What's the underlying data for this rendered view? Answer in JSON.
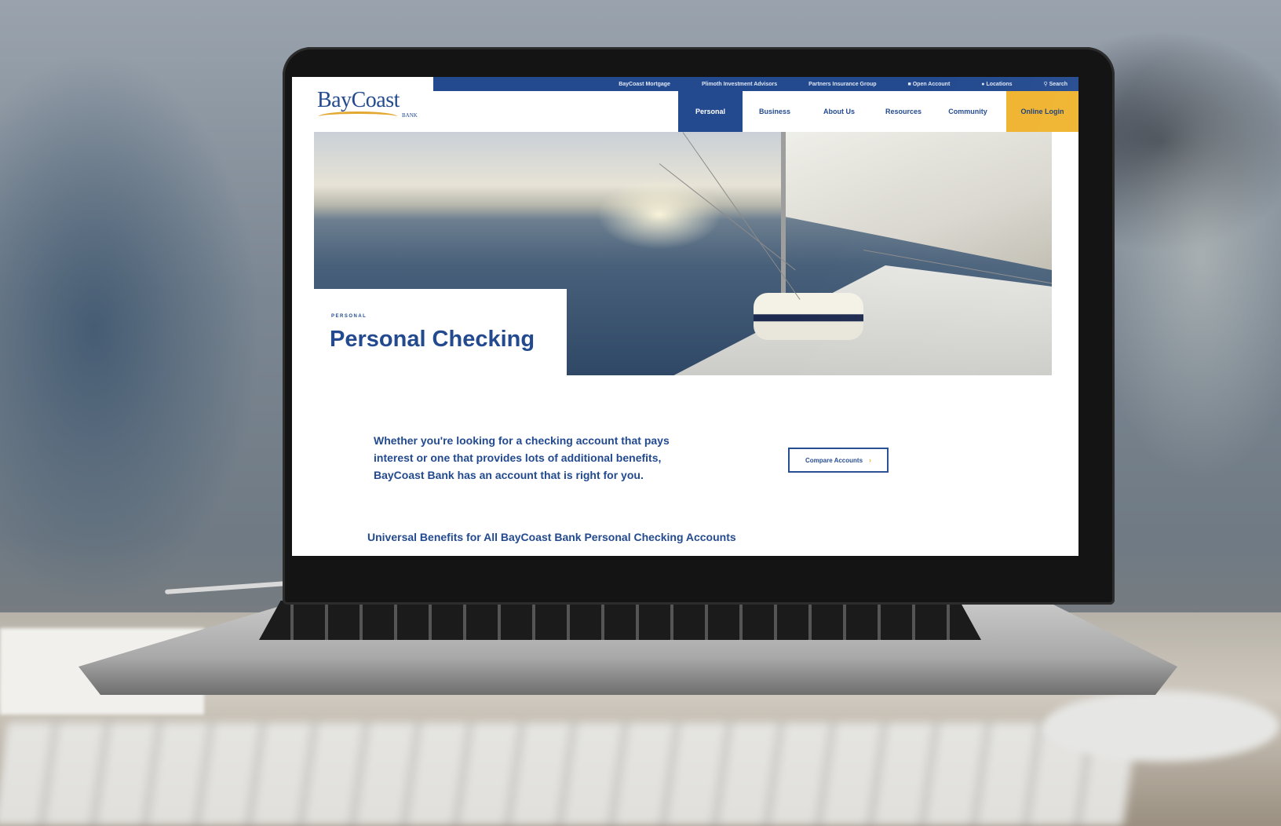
{
  "utility_bar": {
    "links": [
      "BayCoast Mortgage",
      "Plimoth Investment Advisors",
      "Partners Insurance Group"
    ],
    "open_account": "Open Account",
    "locations": "Locations",
    "search": "Search"
  },
  "brand": {
    "logo_text": "BayCoast",
    "logo_subtext": "BANK",
    "primary_color": "#234a8f",
    "accent_color": "#f0b32e"
  },
  "nav": {
    "items": [
      "Personal",
      "Business",
      "About Us",
      "Resources",
      "Community"
    ],
    "active": "Personal",
    "login": "Online Login"
  },
  "hero": {
    "eyebrow": "PERSONAL",
    "title": "Personal Checking"
  },
  "content": {
    "intro": "Whether you're looking for a checking account that pays interest or one that provides lots of additional benefits, BayCoast Bank has an account that is right for you.",
    "cta_label": "Compare Accounts",
    "cta_icon": "chevron-right-icon",
    "section_heading": "Universal Benefits for All BayCoast Bank Personal Checking Accounts"
  }
}
